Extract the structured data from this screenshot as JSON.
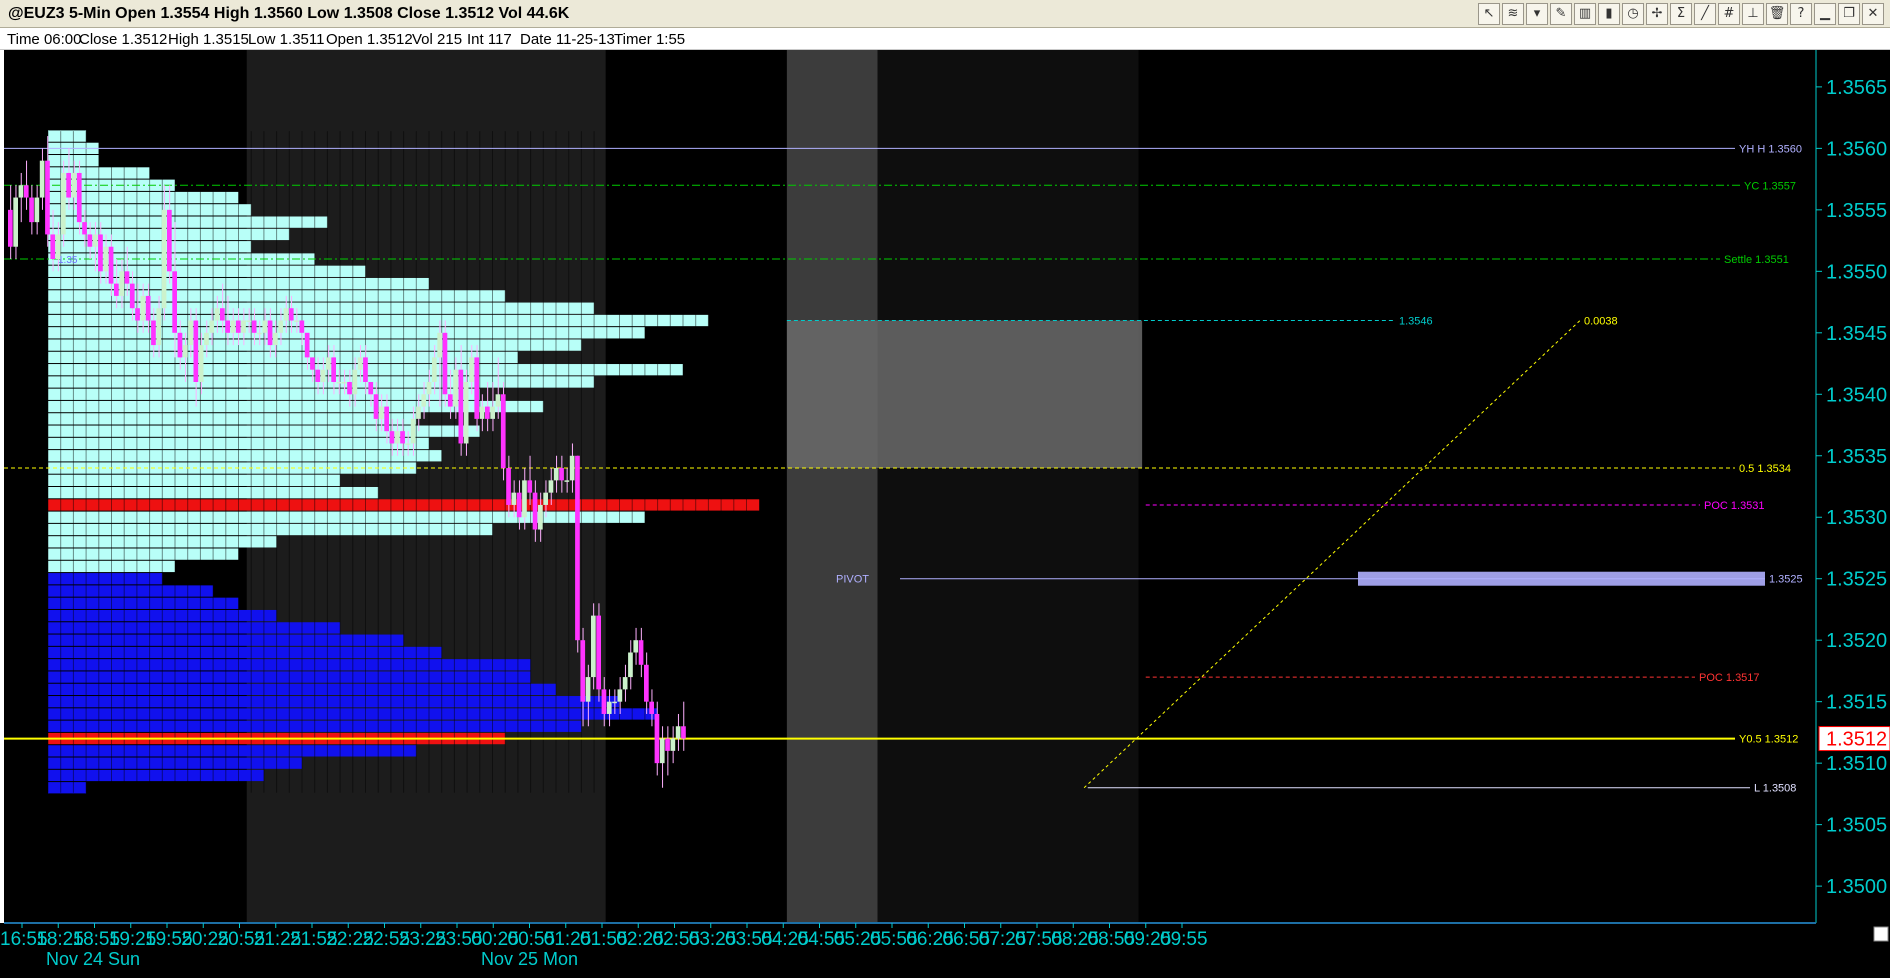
{
  "window": {
    "title": "@EUZ3 5-Min Open 1.3554 High 1.3560 Low 1.3508 Close 1.3512 Vol 44.6K"
  },
  "toolbar": {
    "buttons": [
      {
        "icon": "cursor-icon",
        "glyph": "↖"
      },
      {
        "icon": "wave-icon",
        "glyph": "≋"
      },
      {
        "icon": "drop-icon",
        "glyph": "▾"
      },
      {
        "icon": "pencil-icon",
        "glyph": "✎"
      },
      {
        "icon": "bars-icon",
        "glyph": "▥"
      },
      {
        "icon": "candle-icon",
        "glyph": "▮"
      },
      {
        "icon": "clock-icon",
        "glyph": "◷"
      },
      {
        "icon": "cross-icon",
        "glyph": "✢"
      },
      {
        "icon": "sum-icon",
        "glyph": "Σ"
      },
      {
        "icon": "line-icon",
        "glyph": "╱"
      },
      {
        "icon": "hash-icon",
        "glyph": "#"
      },
      {
        "icon": "mark-icon",
        "glyph": "⊥"
      },
      {
        "icon": "trash-icon",
        "glyph": "🗑"
      },
      {
        "icon": "help-icon",
        "glyph": "?"
      },
      {
        "icon": "minimize-icon",
        "glyph": "▁"
      },
      {
        "icon": "restore-icon",
        "glyph": "❐"
      },
      {
        "icon": "close-icon",
        "glyph": "✕"
      }
    ]
  },
  "info_bar": {
    "time": "Time 06:00",
    "close": "Close 1.3512",
    "high": "High 1.3515",
    "low": "Low 1.3511",
    "open": "Open 1.3512",
    "vol": "Vol 215",
    "int": "Int 117",
    "date": "Date 11-25-13",
    "timer": "Timer 1:55"
  },
  "colors": {
    "background": "#000000",
    "session_shade": "#1c1c1c",
    "axis_text": "#00cccc",
    "candle_up": "#ccf2cc",
    "candle_down": "#ff33ff",
    "profile_value": "#b8fff8",
    "profile_poc": "#ee1111",
    "profile_blue": "#1111ee",
    "pivot": "#b0b0ff"
  },
  "chart_data": {
    "type": "candlestick",
    "title": "",
    "symbol": "@EUZ3",
    "interval": "5-Min",
    "ylim": [
      1.3497,
      1.3568
    ],
    "y_ticks": [
      "1.3500",
      "1.3505",
      "1.3510",
      "1.3515",
      "1.3520",
      "1.3525",
      "1.3530",
      "1.3535",
      "1.3540",
      "1.3545",
      "1.3550",
      "1.3555",
      "1.3560",
      "1.3565"
    ],
    "last_price": "1.3512",
    "x_ticks": [
      "16:55",
      "18:25",
      "18:55",
      "19:25",
      "19:55",
      "20:25",
      "20:55",
      "21:25",
      "21:55",
      "22:25",
      "22:55",
      "23:25",
      "23:55",
      "00:25",
      "00:55",
      "01:25",
      "01:55",
      "02:25",
      "02:55",
      "03:25",
      "03:55",
      "04:25",
      "04:55",
      "05:25",
      "05:55",
      "06:25",
      "06:55",
      "07:25",
      "07:55",
      "08:25",
      "08:55",
      "09:25",
      "09:55"
    ],
    "date_labels": [
      {
        "label": "Nov 24 Sun",
        "at": "16:55"
      },
      {
        "label": "Nov 25 Mon",
        "at": "23:55"
      }
    ],
    "levels": [
      {
        "label": "YH H 1.3560",
        "price": 1.356,
        "color": "#b0b0ff",
        "style": "solid"
      },
      {
        "label": "YC 1.3557",
        "price": 1.3557,
        "color": "#00cc00",
        "style": "dashdot"
      },
      {
        "label": "Settle 1.3551",
        "price": 1.3551,
        "color": "#00cc00",
        "style": "dashdot"
      },
      {
        "label": "1.3546",
        "price": 1.3546,
        "color": "#00cccc",
        "style": "dashed"
      },
      {
        "label": "0.5 1.3534",
        "price": 1.3534,
        "color": "#ffff00",
        "style": "dashed"
      },
      {
        "label": "POC 1.3531",
        "price": 1.3531,
        "color": "#ff00ff",
        "style": "dashed"
      },
      {
        "label": "1.3525",
        "price": 1.3525,
        "color": "#b0b0ff",
        "style": "solid"
      },
      {
        "label": "POC 1.3517",
        "price": 1.3517,
        "color": "#ff3333",
        "style": "dashed"
      },
      {
        "label": "Y0.5 1.3512",
        "price": 1.3512,
        "color": "#ffff00",
        "style": "solid"
      },
      {
        "label": "L 1.3508",
        "price": 1.3508,
        "color": "#e0e0ff",
        "style": "solid"
      }
    ],
    "pivot_label": "PIVOT",
    "measure_label": "0.0038",
    "profile_label": "1.35",
    "candles": [
      [
        1.3555,
        1.3557,
        1.3551,
        1.3552
      ],
      [
        1.3552,
        1.3557,
        1.3551,
        1.3556
      ],
      [
        1.3556,
        1.3558,
        1.3554,
        1.3557
      ],
      [
        1.3557,
        1.3559,
        1.3555,
        1.3556
      ],
      [
        1.3556,
        1.3557,
        1.3553,
        1.3554
      ],
      [
        1.3554,
        1.3557,
        1.3553,
        1.3556
      ],
      [
        1.3556,
        1.356,
        1.3555,
        1.3559
      ],
      [
        1.3559,
        1.3561,
        1.3552,
        1.3553
      ],
      [
        1.3553,
        1.3555,
        1.355,
        1.3551
      ],
      [
        1.3551,
        1.3554,
        1.355,
        1.3553
      ],
      [
        1.3553,
        1.3559,
        1.3552,
        1.3558
      ],
      [
        1.3558,
        1.356,
        1.3555,
        1.3556
      ],
      [
        1.3556,
        1.3559,
        1.3555,
        1.3558
      ],
      [
        1.3558,
        1.3559,
        1.3553,
        1.3554
      ],
      [
        1.3554,
        1.3555,
        1.3552,
        1.3553
      ],
      [
        1.3553,
        1.3554,
        1.3551,
        1.3552
      ],
      [
        1.3552,
        1.3554,
        1.355,
        1.3553
      ],
      [
        1.3553,
        1.3554,
        1.3549,
        1.355
      ],
      [
        1.355,
        1.3553,
        1.3549,
        1.3552
      ],
      [
        1.3552,
        1.3553,
        1.3548,
        1.3549
      ],
      [
        1.3549,
        1.3551,
        1.3547,
        1.3548
      ],
      [
        1.3548,
        1.3551,
        1.3547,
        1.355
      ],
      [
        1.355,
        1.3552,
        1.3548,
        1.3549
      ],
      [
        1.3549,
        1.355,
        1.3546,
        1.3547
      ],
      [
        1.3547,
        1.3549,
        1.3545,
        1.3546
      ],
      [
        1.3546,
        1.3549,
        1.3545,
        1.3548
      ],
      [
        1.3548,
        1.3549,
        1.3545,
        1.3546
      ],
      [
        1.3546,
        1.3547,
        1.3543,
        1.3544
      ],
      [
        1.3544,
        1.3548,
        1.3543,
        1.3547
      ],
      [
        1.3547,
        1.3557,
        1.3546,
        1.3555
      ],
      [
        1.3555,
        1.3557,
        1.3549,
        1.355
      ],
      [
        1.355,
        1.3554,
        1.3543,
        1.3545
      ],
      [
        1.3545,
        1.3546,
        1.3542,
        1.3543
      ],
      [
        1.3543,
        1.3545,
        1.3541,
        1.3544
      ],
      [
        1.3544,
        1.3547,
        1.3543,
        1.3546
      ],
      [
        1.3546,
        1.3547,
        1.3539,
        1.3541
      ],
      [
        1.3541,
        1.3545,
        1.354,
        1.3544
      ],
      [
        1.3544,
        1.3546,
        1.3543,
        1.3545
      ],
      [
        1.3545,
        1.3547,
        1.3544,
        1.3546
      ],
      [
        1.3546,
        1.3548,
        1.3545,
        1.3547
      ],
      [
        1.3547,
        1.3549,
        1.3545,
        1.3546
      ],
      [
        1.3546,
        1.3548,
        1.3544,
        1.3545
      ],
      [
        1.3545,
        1.3547,
        1.3544,
        1.3546
      ],
      [
        1.3546,
        1.3547,
        1.3544,
        1.3545
      ],
      [
        1.3545,
        1.3547,
        1.3544,
        1.3546
      ],
      [
        1.3546,
        1.3547,
        1.3545,
        1.3546
      ],
      [
        1.3546,
        1.3547,
        1.3544,
        1.3545
      ],
      [
        1.3545,
        1.3546,
        1.3544,
        1.3545
      ],
      [
        1.3545,
        1.3547,
        1.3544,
        1.3546
      ],
      [
        1.3546,
        1.3547,
        1.3543,
        1.3544
      ],
      [
        1.3544,
        1.3546,
        1.3543,
        1.3545
      ],
      [
        1.3545,
        1.3547,
        1.3544,
        1.3546
      ],
      [
        1.3546,
        1.3548,
        1.3545,
        1.3547
      ],
      [
        1.3547,
        1.3548,
        1.3545,
        1.3546
      ],
      [
        1.3546,
        1.3547,
        1.3545,
        1.3546
      ],
      [
        1.3546,
        1.3546,
        1.3544,
        1.3545
      ],
      [
        1.3545,
        1.3545,
        1.3542,
        1.3543
      ],
      [
        1.3543,
        1.3543,
        1.3541,
        1.3542
      ],
      [
        1.3542,
        1.3543,
        1.354,
        1.3541
      ],
      [
        1.3541,
        1.3543,
        1.354,
        1.3542
      ],
      [
        1.3542,
        1.3544,
        1.3541,
        1.3543
      ],
      [
        1.3543,
        1.3544,
        1.354,
        1.3541
      ],
      [
        1.3541,
        1.3542,
        1.354,
        1.3541
      ],
      [
        1.3541,
        1.3542,
        1.354,
        1.3541
      ],
      [
        1.3541,
        1.3542,
        1.3539,
        1.354
      ],
      [
        1.354,
        1.3543,
        1.3539,
        1.3542
      ],
      [
        1.3542,
        1.3544,
        1.3541,
        1.3543
      ],
      [
        1.3543,
        1.3544,
        1.354,
        1.3541
      ],
      [
        1.3541,
        1.3541,
        1.3539,
        1.354
      ],
      [
        1.354,
        1.3541,
        1.3537,
        1.3538
      ],
      [
        1.3538,
        1.354,
        1.3537,
        1.3539
      ],
      [
        1.3539,
        1.354,
        1.3536,
        1.3537
      ],
      [
        1.3537,
        1.3538,
        1.3535,
        1.3536
      ],
      [
        1.3536,
        1.3538,
        1.3535,
        1.3537
      ],
      [
        1.3537,
        1.3538,
        1.3535,
        1.3536
      ],
      [
        1.3536,
        1.3537,
        1.3535,
        1.3536
      ],
      [
        1.3536,
        1.3539,
        1.3535,
        1.3538
      ],
      [
        1.3538,
        1.354,
        1.3537,
        1.3539
      ],
      [
        1.3539,
        1.3541,
        1.3538,
        1.354
      ],
      [
        1.354,
        1.3542,
        1.3539,
        1.3541
      ],
      [
        1.3541,
        1.3544,
        1.354,
        1.3543
      ],
      [
        1.3543,
        1.3546,
        1.3539,
        1.3545
      ],
      [
        1.3545,
        1.3546,
        1.3539,
        1.354
      ],
      [
        1.354,
        1.3542,
        1.3538,
        1.3539
      ],
      [
        1.3539,
        1.3543,
        1.3538,
        1.3542
      ],
      [
        1.3542,
        1.3544,
        1.3535,
        1.3536
      ],
      [
        1.3536,
        1.3542,
        1.3535,
        1.3541
      ],
      [
        1.3541,
        1.3544,
        1.354,
        1.3543
      ],
      [
        1.3543,
        1.3544,
        1.3537,
        1.3538
      ],
      [
        1.3538,
        1.354,
        1.3537,
        1.3539
      ],
      [
        1.3539,
        1.3541,
        1.3537,
        1.3538
      ],
      [
        1.3538,
        1.3541,
        1.3537,
        1.3539
      ],
      [
        1.3539,
        1.3543,
        1.3538,
        1.354
      ],
      [
        1.354,
        1.3541,
        1.3533,
        1.3534
      ],
      [
        1.3534,
        1.3535,
        1.353,
        1.3531
      ],
      [
        1.3531,
        1.3533,
        1.353,
        1.3532
      ],
      [
        1.3532,
        1.3533,
        1.3529,
        1.353
      ],
      [
        1.353,
        1.3534,
        1.3529,
        1.3533
      ],
      [
        1.3533,
        1.3535,
        1.3531,
        1.3532
      ],
      [
        1.3532,
        1.3533,
        1.3528,
        1.3529
      ],
      [
        1.3529,
        1.3532,
        1.3528,
        1.3531
      ],
      [
        1.3531,
        1.3533,
        1.353,
        1.3532
      ],
      [
        1.3532,
        1.3534,
        1.3531,
        1.3533
      ],
      [
        1.3533,
        1.3535,
        1.3532,
        1.3534
      ],
      [
        1.3534,
        1.3535,
        1.3532,
        1.3533
      ],
      [
        1.3533,
        1.3534,
        1.3532,
        1.3533
      ],
      [
        1.3533,
        1.3536,
        1.3532,
        1.3535
      ],
      [
        1.3535,
        1.3535,
        1.3519,
        1.352
      ],
      [
        1.352,
        1.3521,
        1.3513,
        1.3515
      ],
      [
        1.3515,
        1.3518,
        1.3513,
        1.3517
      ],
      [
        1.3517,
        1.3523,
        1.3516,
        1.3522
      ],
      [
        1.3522,
        1.3523,
        1.3515,
        1.3516
      ],
      [
        1.3516,
        1.3517,
        1.3513,
        1.3514
      ],
      [
        1.3514,
        1.3516,
        1.3513,
        1.3515
      ],
      [
        1.3515,
        1.3516,
        1.3514,
        1.3515
      ],
      [
        1.3515,
        1.3517,
        1.3514,
        1.3516
      ],
      [
        1.3516,
        1.3518,
        1.3515,
        1.3517
      ],
      [
        1.3517,
        1.352,
        1.3516,
        1.3519
      ],
      [
        1.3519,
        1.3521,
        1.3518,
        1.352
      ],
      [
        1.352,
        1.3521,
        1.3517,
        1.3518
      ],
      [
        1.3518,
        1.3519,
        1.3514,
        1.3515
      ],
      [
        1.3515,
        1.3516,
        1.3513,
        1.3514
      ],
      [
        1.3514,
        1.3515,
        1.3509,
        1.351
      ],
      [
        1.351,
        1.3513,
        1.3508,
        1.3512
      ],
      [
        1.3512,
        1.3513,
        1.3509,
        1.3511
      ],
      [
        1.3511,
        1.3513,
        1.351,
        1.3512
      ],
      [
        1.3512,
        1.3514,
        1.3511,
        1.3513
      ],
      [
        1.3513,
        1.3515,
        1.3511,
        1.3512
      ]
    ],
    "profiles": [
      {
        "name": "overnight-profile",
        "poc": 1.3531,
        "rows": [
          [
            1.3561,
            3
          ],
          [
            1.356,
            4
          ],
          [
            1.3559,
            4
          ],
          [
            1.3558,
            8
          ],
          [
            1.3557,
            10
          ],
          [
            1.3556,
            15
          ],
          [
            1.3555,
            16
          ],
          [
            1.3554,
            22
          ],
          [
            1.3553,
            19
          ],
          [
            1.3552,
            16
          ],
          [
            1.3551,
            21
          ],
          [
            1.355,
            25
          ],
          [
            1.3549,
            30
          ],
          [
            1.3548,
            36
          ],
          [
            1.3547,
            43
          ],
          [
            1.3546,
            52
          ],
          [
            1.3545,
            47
          ],
          [
            1.3544,
            42
          ],
          [
            1.3543,
            37
          ],
          [
            1.3542,
            50
          ],
          [
            1.3541,
            43
          ],
          [
            1.354,
            34
          ],
          [
            1.3539,
            39
          ],
          [
            1.3538,
            29
          ],
          [
            1.3537,
            34
          ],
          [
            1.3536,
            30
          ],
          [
            1.3535,
            31
          ],
          [
            1.3534,
            29
          ],
          [
            1.3533,
            23
          ],
          [
            1.3532,
            26
          ],
          [
            1.3531,
            56
          ],
          [
            1.353,
            47
          ],
          [
            1.3529,
            35
          ],
          [
            1.3528,
            18
          ],
          [
            1.3527,
            15
          ],
          [
            1.3526,
            10
          ]
        ]
      },
      {
        "name": "prior-day-profile",
        "poc": 1.3512,
        "rows": [
          [
            1.3525,
            9
          ],
          [
            1.3524,
            13
          ],
          [
            1.3523,
            15
          ],
          [
            1.3522,
            18
          ],
          [
            1.3521,
            23
          ],
          [
            1.352,
            28
          ],
          [
            1.3519,
            31
          ],
          [
            1.3518,
            38
          ],
          [
            1.3517,
            38
          ],
          [
            1.3516,
            40
          ],
          [
            1.3515,
            45
          ],
          [
            1.3514,
            48
          ],
          [
            1.3513,
            42
          ],
          [
            1.3512,
            36
          ],
          [
            1.3511,
            29
          ],
          [
            1.351,
            20
          ],
          [
            1.3509,
            17
          ],
          [
            1.3508,
            3
          ]
        ]
      }
    ]
  }
}
